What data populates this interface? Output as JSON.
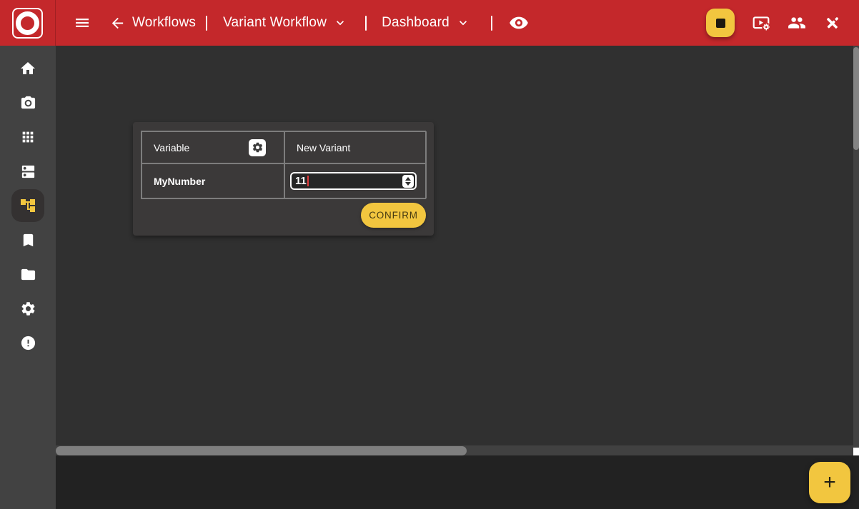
{
  "topbar": {
    "workflows_label": "Workflows",
    "workflow_selector": "Variant Workflow",
    "dashboard_selector": "Dashboard",
    "separator": "|"
  },
  "variant_panel": {
    "columns": {
      "variable": "Variable",
      "new_variant": "New Variant"
    },
    "rows": [
      {
        "variable": "MyNumber",
        "value": "11"
      }
    ],
    "confirm_label": "CONFIRM"
  },
  "fab_label": "+",
  "icons": {
    "topbar": [
      "menu-icon",
      "back-arrow-icon",
      "chevron-down-icon",
      "eye-icon",
      "stop-icon",
      "video-settings-icon",
      "people-icon",
      "edit-off-icon"
    ],
    "sidebar": [
      "home-icon",
      "camera-icon",
      "apps-grid-icon",
      "dns-icon",
      "workflow-tree-icon",
      "bookmark-icon",
      "folder-icon",
      "gear-icon",
      "error-icon"
    ],
    "panel": [
      "gear-icon",
      "number-spinner-icon"
    ]
  },
  "colors": {
    "topbar_red": "#c4282b",
    "accent_yellow": "#f2c63f",
    "sidebar_gray": "#424242",
    "content_gray": "#303030",
    "card_gray": "#3b3939",
    "bottom_band": "#222222",
    "caret_red": "#e23b3b",
    "scroll_thumb": "#7f7f7f"
  },
  "sidebar": {
    "active_item": "workflow-tree"
  }
}
